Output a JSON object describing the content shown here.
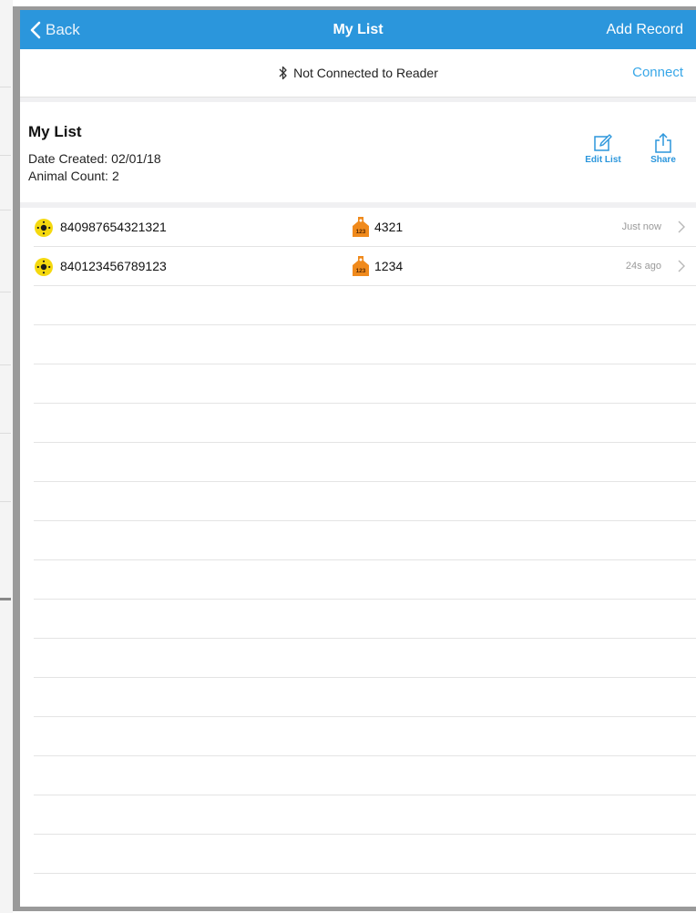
{
  "nav": {
    "back_label": "Back",
    "title": "My List",
    "add_label": "Add Record"
  },
  "connection": {
    "status": "Not Connected to Reader",
    "action": "Connect"
  },
  "list_header": {
    "name": "My List",
    "date_label": "Date Created:",
    "date_value": "02/01/18",
    "count_label": "Animal Count:",
    "count_value": "2",
    "edit_label": "Edit List",
    "share_label": "Share"
  },
  "records": [
    {
      "eid": "840987654321321",
      "visual_tag": "4321",
      "visual_tag_badge": "123",
      "time": "Just now"
    },
    {
      "eid": "840123456789123",
      "visual_tag": "1234",
      "visual_tag_badge": "123",
      "time": "24s ago"
    }
  ],
  "colors": {
    "accent": "#2b96dc",
    "link": "#38a7e8",
    "eid_tag": "#f5d90f",
    "visual_tag": "#f08a1c"
  },
  "icons": {
    "back": "chevron-left-icon",
    "bluetooth": "bluetooth-icon",
    "edit": "edit-icon",
    "share": "share-icon",
    "eid_tag": "eid-tag-icon",
    "visual_tag": "visual-tag-icon",
    "row_arrow": "chevron-right-icon"
  }
}
